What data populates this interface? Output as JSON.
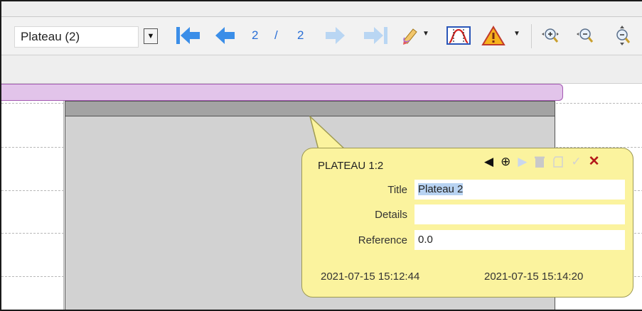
{
  "toolbar": {
    "combo_value": "Plateau (2)",
    "combo_arrow": "▼",
    "page_current": "2",
    "page_sep": "/",
    "page_total": "2",
    "icons": [
      "first-page-icon",
      "previous-page-icon",
      "next-page-icon",
      "last-page-icon",
      "edit-tag-icon",
      "dropdown-icon",
      "curve-window-icon",
      "warning-icon",
      "zoom-in-icon",
      "zoom-out-icon",
      "zoom-fit-icon"
    ]
  },
  "popup": {
    "title": "PLATEAU 1:2",
    "fields": {
      "title_label": "Title",
      "title_value": "Plateau 2",
      "details_label": "Details",
      "details_value": "",
      "reference_label": "Reference",
      "reference_value": "0.0"
    },
    "start_time": "2021-07-15 15:12:44",
    "end_time": "2021-07-15 15:14:20",
    "icons": {
      "prev": "◀",
      "move": "⊕",
      "next": "▶",
      "delete": "🗑",
      "copy": "□",
      "confirm": "✓",
      "close": "✕"
    }
  },
  "colors": {
    "band_fill": "#e2c4ea",
    "band_border": "#a45ab2",
    "popup_fill": "#fbf39e",
    "nav_blue": "#2a6fd6",
    "close_red": "#b3171a"
  }
}
